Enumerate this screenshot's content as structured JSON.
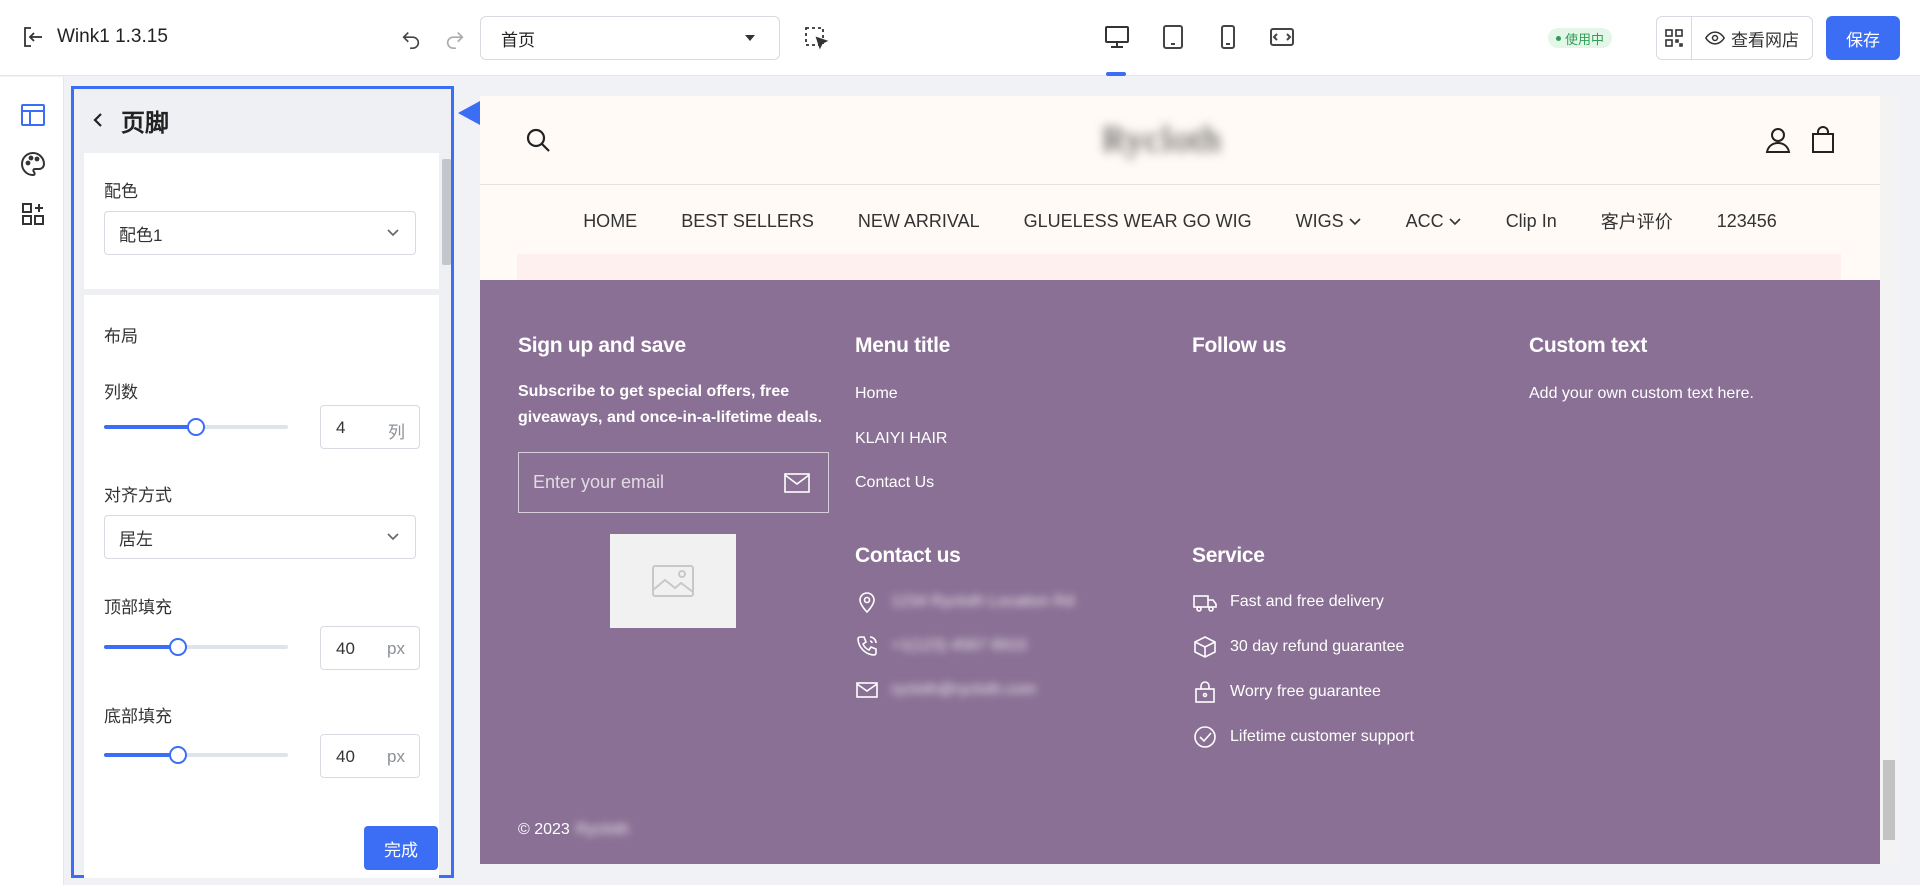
{
  "app": {
    "title": "Wink1 1.3.15"
  },
  "toolbar": {
    "page_select": "首页",
    "status": "使用中",
    "view_store": "查看网店",
    "save": "保存"
  },
  "panel": {
    "title": "页脚",
    "color_label": "配色",
    "color_value": "配色1",
    "layout_label": "布局",
    "columns_label": "列数",
    "columns_value": "4",
    "columns_unit": "列",
    "columns_level": 0.5,
    "align_label": "对齐方式",
    "align_value": "居左",
    "top_pad_label": "顶部填充",
    "top_pad_value": "40",
    "top_pad_unit": "px",
    "top_pad_level": 0.4,
    "bottom_pad_label": "底部填充",
    "bottom_pad_value": "40",
    "bottom_pad_unit": "px",
    "bottom_pad_level": 0.4,
    "done": "完成"
  },
  "preview": {
    "logo": "Rycloth",
    "nav": [
      "HOME",
      "BEST SELLERS",
      "NEW ARRIVAL",
      "GLUELESS WEAR GO WIG",
      "WIGS",
      "ACC",
      "Clip In",
      "客户评价",
      "123456"
    ],
    "signup": {
      "title": "Sign up and save",
      "text": "Subscribe to get special offers, free giveaways, and once-in-a-lifetime deals.",
      "placeholder": "Enter your email"
    },
    "menu": {
      "title": "Menu title",
      "items": [
        "Home",
        "KLAIYI HAIR",
        "Contact Us"
      ]
    },
    "follow": {
      "title": "Follow us"
    },
    "custom": {
      "title": "Custom text",
      "text": "Add your own custom text here."
    },
    "contact": {
      "title": "Contact us",
      "address": "1234 Rycloth Location Rd",
      "phone": "+1(123) 4567 8910",
      "email": "rycloth@rycloth.com"
    },
    "service": {
      "title": "Service",
      "items": [
        "Fast and free delivery",
        "30 day refund guarantee",
        "Worry free guarantee",
        "Lifetime customer support"
      ]
    },
    "copyright": "© 2023",
    "copyright_name": "Rycloth"
  }
}
